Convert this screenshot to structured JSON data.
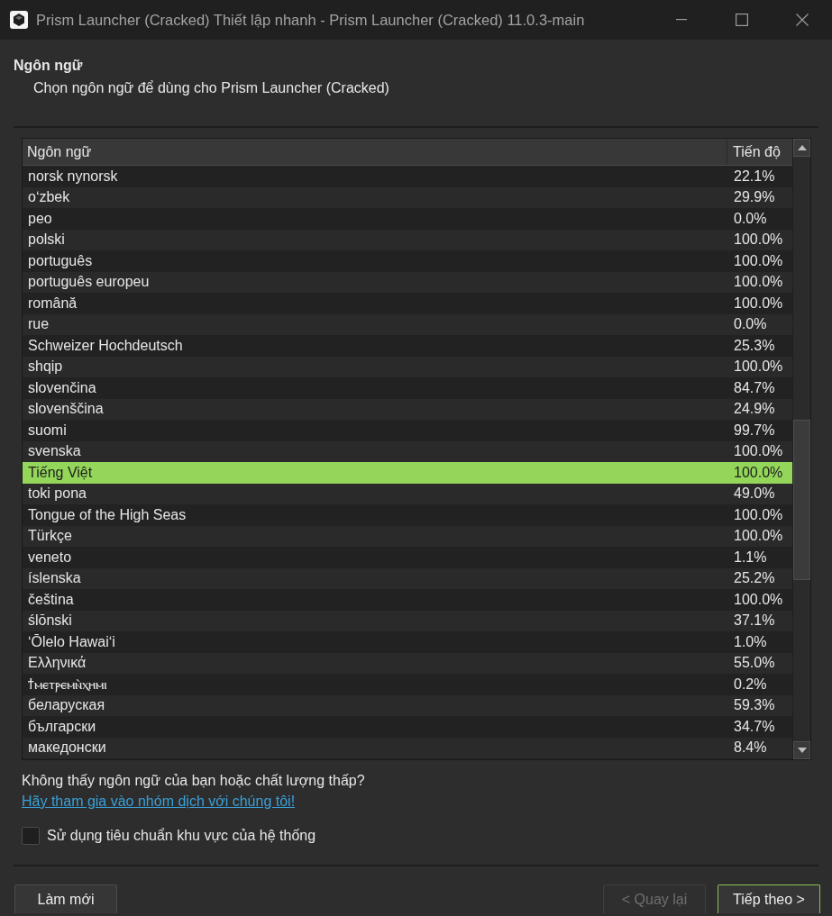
{
  "window": {
    "title": "Prism Launcher (Cracked) Thiết lập nhanh - Prism Launcher (Cracked) 11.0.3-main"
  },
  "page": {
    "title": "Ngôn ngữ",
    "subtitle": "Chọn ngôn ngữ để dùng cho Prism Launcher (Cracked)"
  },
  "table": {
    "columns": [
      "Ngôn ngữ",
      "Tiến độ"
    ],
    "rows": [
      {
        "language": "norsk nynorsk",
        "progress": "22.1%",
        "selected": false
      },
      {
        "language": "oʻzbek",
        "progress": "29.9%",
        "selected": false
      },
      {
        "language": "peo",
        "progress": "0.0%",
        "selected": false
      },
      {
        "language": "polski",
        "progress": "100.0%",
        "selected": false
      },
      {
        "language": "português",
        "progress": "100.0%",
        "selected": false
      },
      {
        "language": "português europeu",
        "progress": "100.0%",
        "selected": false
      },
      {
        "language": "română",
        "progress": "100.0%",
        "selected": false
      },
      {
        "language": "rue",
        "progress": "0.0%",
        "selected": false
      },
      {
        "language": "Schweizer Hochdeutsch",
        "progress": "25.3%",
        "selected": false
      },
      {
        "language": "shqip",
        "progress": "100.0%",
        "selected": false
      },
      {
        "language": "slovenčina",
        "progress": "84.7%",
        "selected": false
      },
      {
        "language": "slovenščina",
        "progress": "24.9%",
        "selected": false
      },
      {
        "language": "suomi",
        "progress": "99.7%",
        "selected": false
      },
      {
        "language": "svenska",
        "progress": "100.0%",
        "selected": false
      },
      {
        "language": "Tiếng Việt",
        "progress": "100.0%",
        "selected": true
      },
      {
        "language": "toki pona",
        "progress": "49.0%",
        "selected": false
      },
      {
        "language": "Tongue of the High Seas",
        "progress": "100.0%",
        "selected": false
      },
      {
        "language": "Türkçe",
        "progress": "100.0%",
        "selected": false
      },
      {
        "language": "veneto",
        "progress": "1.1%",
        "selected": false
      },
      {
        "language": "íslenska",
        "progress": "25.2%",
        "selected": false
      },
      {
        "language": "čeština",
        "progress": "100.0%",
        "selected": false
      },
      {
        "language": "ślōnski",
        "progress": "37.1%",
        "selected": false
      },
      {
        "language": "ʻŌlelo Hawaiʻi",
        "progress": "1.0%",
        "selected": false
      },
      {
        "language": "Ελληνικά",
        "progress": "55.0%",
        "selected": false
      },
      {
        "language": "ϯⲙⲉⲧⲣⲉⲙⲛ̀ⲭⲏⲙⲓ",
        "progress": "0.2%",
        "selected": false
      },
      {
        "language": "беларуская",
        "progress": "59.3%",
        "selected": false
      },
      {
        "language": "български",
        "progress": "34.7%",
        "selected": false
      },
      {
        "language": "македонски",
        "progress": "8.4%",
        "selected": false
      }
    ]
  },
  "hint": "Không thấy ngôn ngữ của bạn hoặc chất lượng thấp?",
  "link": "Hãy tham gia vào nhóm dịch với chúng tôi!",
  "checkbox": {
    "label": "Sử dụng tiêu chuẩn khu vực của hệ thống",
    "checked": false
  },
  "buttons": {
    "left": [
      {
        "label": "Làm mới",
        "disabled": false,
        "focused": false
      }
    ],
    "right": [
      {
        "label": "< Quay lại",
        "disabled": true,
        "focused": false
      },
      {
        "label": "Tiếp theo >",
        "disabled": false,
        "focused": true
      }
    ]
  }
}
